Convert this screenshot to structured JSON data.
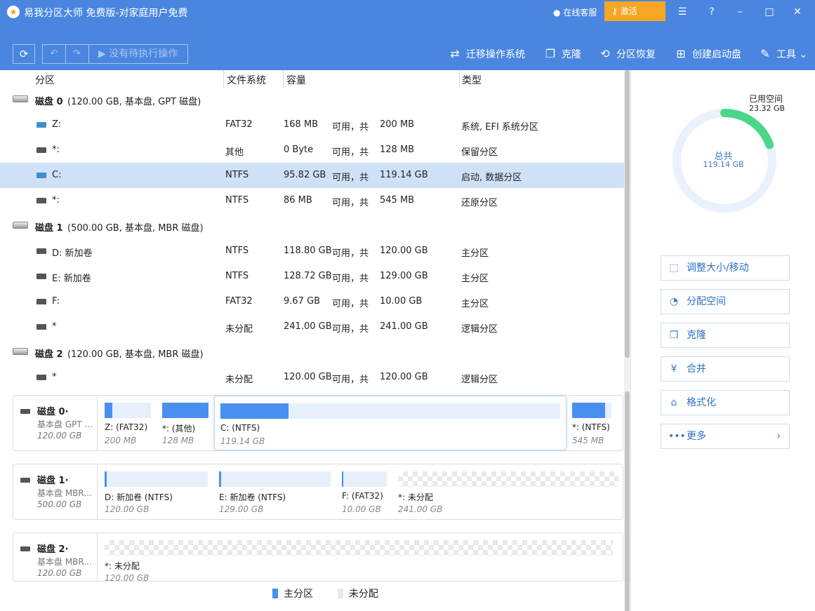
{
  "titlebar": {
    "title": "易我分区大师 免费版-对家庭用户免费",
    "online_service": "在线客服",
    "activate": "激活"
  },
  "toolbar": {
    "pending": "没有待执行操作",
    "migrate_os": "迁移操作系统",
    "clone": "克隆",
    "recover": "分区恢复",
    "bootable": "创建启动盘",
    "tools": "工具"
  },
  "table": {
    "headers": [
      "分区",
      "文件系统",
      "容量",
      "类型"
    ],
    "disks": [
      {
        "name": "磁盘 0",
        "info": "(120.00 GB, 基本盘, GPT 磁盘)",
        "partitions": [
          {
            "name": "Z:",
            "fs": "FAT32",
            "free": "168 MB",
            "avail": "可用，共",
            "total": "200 MB",
            "type": "系统, EFI 系统分区",
            "icon": "system"
          },
          {
            "name": "*:",
            "fs": "其他",
            "free": "0 Byte",
            "avail": "可用，共",
            "total": "128 MB",
            "type": "保留分区",
            "icon": "drive"
          },
          {
            "name": "C:",
            "fs": "NTFS",
            "free": "95.82 GB",
            "avail": "可用，共",
            "total": "119.14 GB",
            "type": "启动, 数据分区",
            "icon": "system"
          },
          {
            "name": "*:",
            "fs": "NTFS",
            "free": "86 MB",
            "avail": "可用，共",
            "total": "545 MB",
            "type": "还原分区",
            "icon": "drive"
          }
        ]
      },
      {
        "name": "磁盘 1",
        "info": "(500.00 GB, 基本盘, MBR 磁盘)",
        "partitions": [
          {
            "name": "D: 新加卷",
            "fs": "NTFS",
            "free": "118.80 GB",
            "avail": "可用，共",
            "total": "120.00 GB",
            "type": "主分区",
            "icon": "drive"
          },
          {
            "name": "E: 新加卷",
            "fs": "NTFS",
            "free": "128.72 GB",
            "avail": "可用，共",
            "total": "129.00 GB",
            "type": "主分区",
            "icon": "drive"
          },
          {
            "name": "F:",
            "fs": "FAT32",
            "free": "9.67 GB",
            "avail": "可用，共",
            "total": "10.00 GB",
            "type": "主分区",
            "icon": "drive"
          },
          {
            "name": "*",
            "fs": "未分配",
            "free": "241.00 GB",
            "avail": "可用，共",
            "total": "241.00 GB",
            "type": "逻辑分区",
            "icon": "drive"
          }
        ]
      },
      {
        "name": "磁盘 2",
        "info": "(120.00 GB, 基本盘, MBR 磁盘)",
        "partitions": [
          {
            "name": "*",
            "fs": "未分配",
            "free": "120.00 GB",
            "avail": "可用，共",
            "total": "120.00 GB",
            "type": "逻辑分区",
            "icon": "drive"
          }
        ]
      }
    ]
  },
  "disk_map": [
    {
      "name": "磁盘 0·",
      "type": "基本盘 GPT ...",
      "size": "120.00 GB",
      "segments": [
        {
          "label": "Z: (FAT32)",
          "size": "200 MB",
          "used": 0.16,
          "unalloc": false
        },
        {
          "label": "*: (其他)",
          "size": "128 MB",
          "used": 1.0,
          "unalloc": false
        },
        {
          "label": "C: (NTFS)",
          "size": "119.14 GB",
          "used": 0.2,
          "unalloc": false
        },
        {
          "label": "*: (NTFS)",
          "size": "545 MB",
          "used": 0.84,
          "unalloc": false
        }
      ]
    },
    {
      "name": "磁盘 1·",
      "type": "基本盘 MBR...",
      "size": "500.00 GB",
      "segments": [
        {
          "label": "D: 新加卷 (NTFS)",
          "size": "120.00 GB",
          "used": 0.01,
          "unalloc": false
        },
        {
          "label": "E: 新加卷 (NTFS)",
          "size": "129.00 GB",
          "used": 0.01,
          "unalloc": false
        },
        {
          "label": "F: (FAT32)",
          "size": "10.00 GB",
          "used": 0.03,
          "unalloc": false
        },
        {
          "label": "*: 未分配",
          "size": "241.00 GB",
          "used": 0,
          "unalloc": true
        }
      ]
    },
    {
      "name": "磁盘 2·",
      "type": "基本盘 MBR...",
      "size": "120.00 GB",
      "segments": [
        {
          "label": "*: 未分配",
          "size": "120.00 GB",
          "used": 0,
          "unalloc": true
        }
      ]
    }
  ],
  "legend": {
    "primary": "主分区",
    "unallocated": "未分配",
    "primary_color": "#4a8ff0",
    "unalloc_color": "#e9e9e9"
  },
  "right_panel": {
    "used_label": "已用空间",
    "used_value": "23.32 GB",
    "used_fraction": 0.196,
    "total_label": "总共",
    "total_value": "119.14 GB",
    "actions": [
      {
        "label": "调整大小/移动",
        "icon": "resize-icon"
      },
      {
        "label": "分配空间",
        "icon": "allocate-icon"
      },
      {
        "label": "克隆",
        "icon": "clone-icon"
      },
      {
        "label": "合并",
        "icon": "merge-icon"
      },
      {
        "label": "格式化",
        "icon": "format-icon"
      },
      {
        "label": "更多",
        "icon": "more-icon"
      }
    ]
  },
  "colors": {
    "accent": "#4a86e0",
    "activate": "#f6a623",
    "selected_row": "#cfe1f7",
    "donut_used": "#4cd68a",
    "donut_track": "#e8f1fc"
  }
}
